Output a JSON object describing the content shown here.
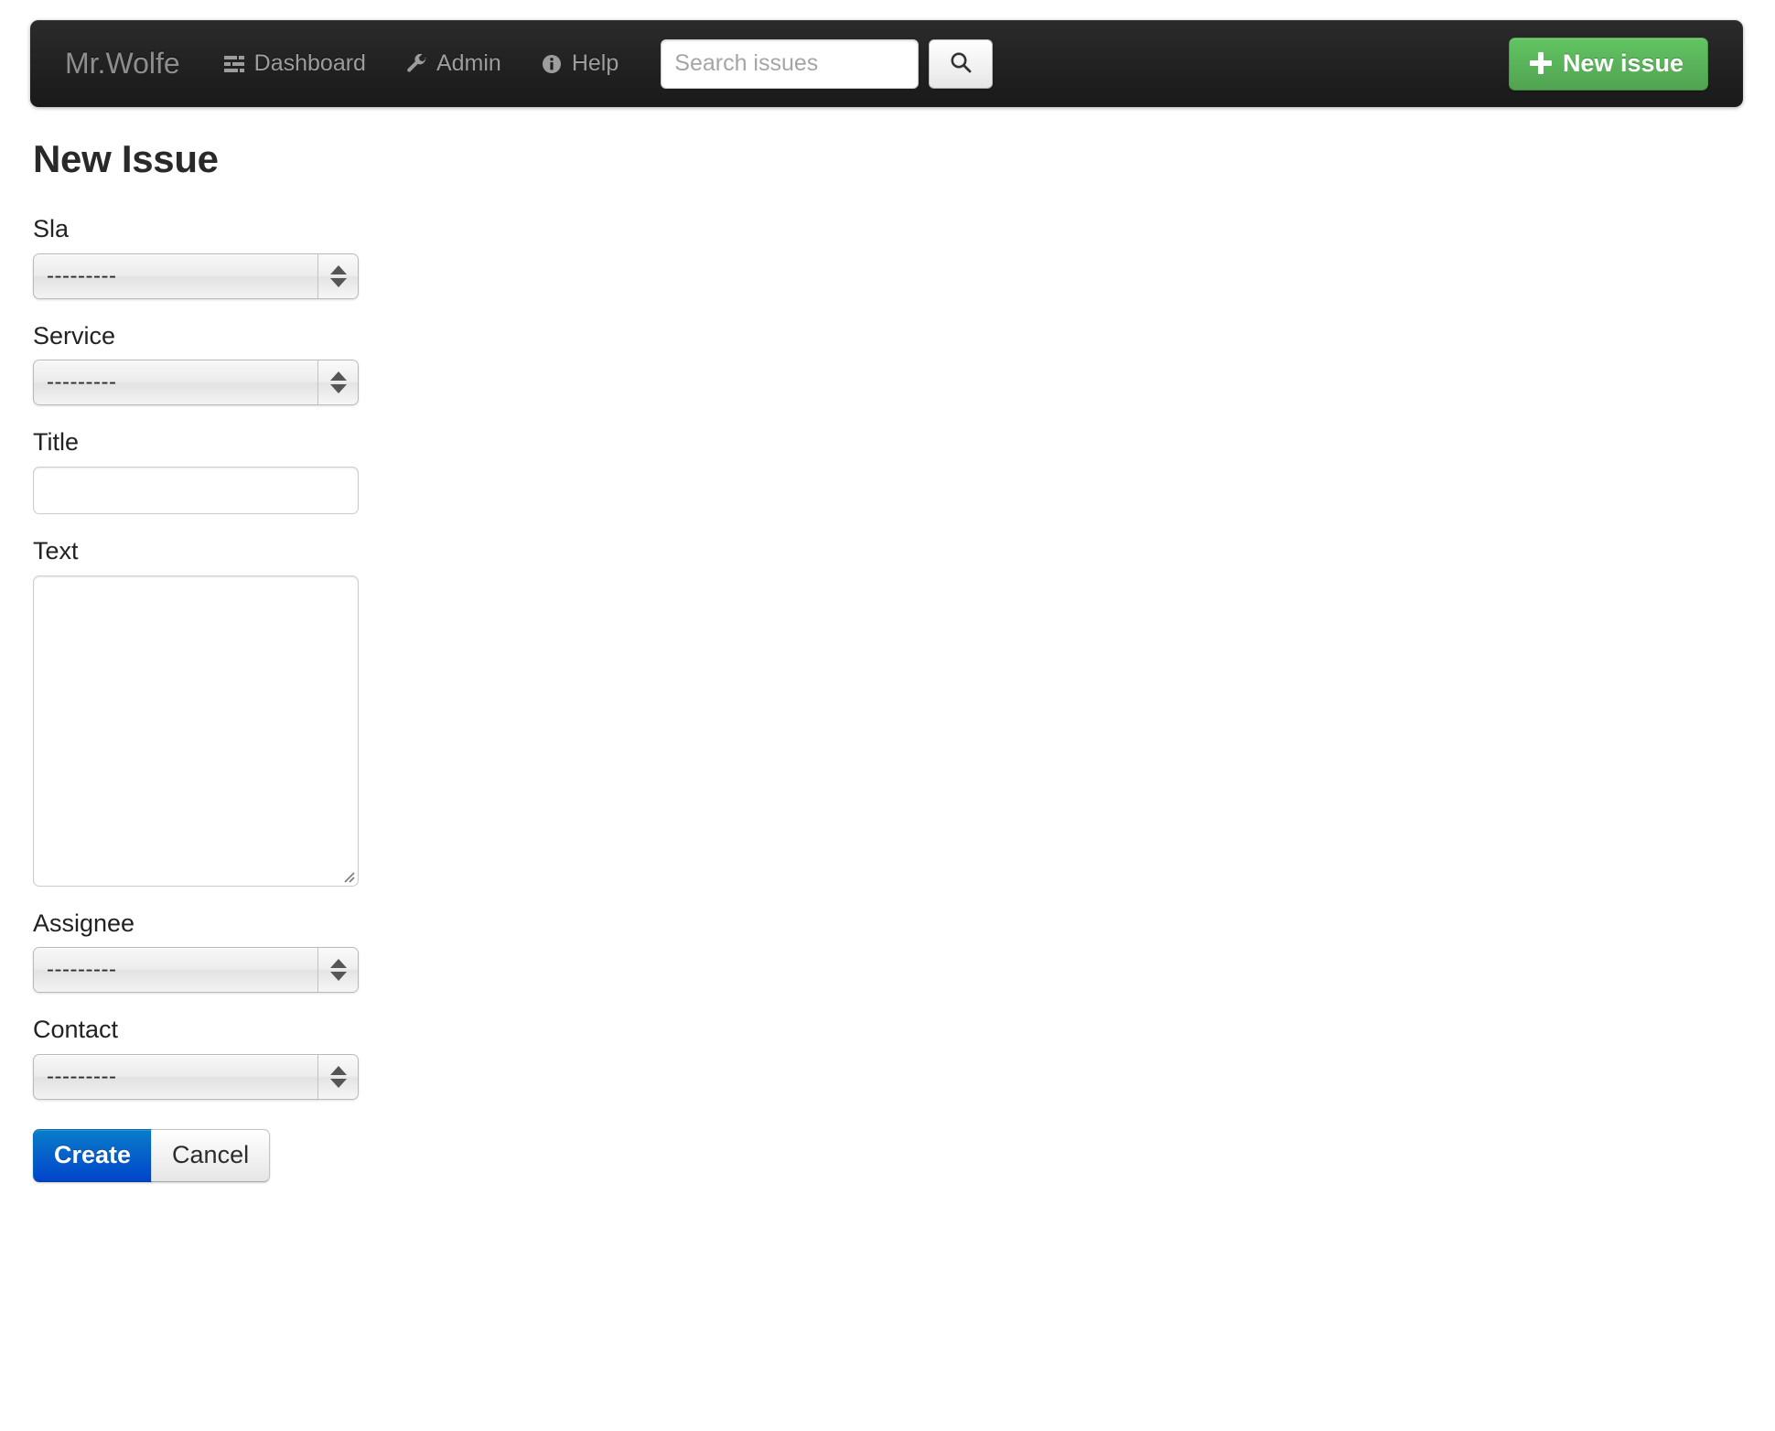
{
  "navbar": {
    "brand": "Mr.Wolfe",
    "links": [
      {
        "label": "Dashboard",
        "icon": "list-icon"
      },
      {
        "label": "Admin",
        "icon": "wrench-icon"
      },
      {
        "label": "Help",
        "icon": "info-circle-icon"
      }
    ],
    "search": {
      "placeholder": "Search issues",
      "value": "",
      "button_icon": "search-icon"
    },
    "new_issue_button": {
      "label": "New issue",
      "icon": "plus-icon",
      "color": "#51a351"
    },
    "background_color": "#1d1d1d"
  },
  "page": {
    "title": "New Issue"
  },
  "form": {
    "fields": [
      {
        "label": "Sla",
        "type": "select",
        "value": "---------"
      },
      {
        "label": "Service",
        "type": "select",
        "value": "---------"
      },
      {
        "label": "Title",
        "type": "text",
        "value": "",
        "placeholder": ""
      },
      {
        "label": "Text",
        "type": "textarea",
        "value": "",
        "placeholder": ""
      },
      {
        "label": "Assignee",
        "type": "select",
        "value": "---------"
      },
      {
        "label": "Contact",
        "type": "select",
        "value": "---------"
      }
    ],
    "actions": {
      "submit_label": "Create",
      "submit_color": "#0044cc",
      "cancel_label": "Cancel"
    }
  }
}
